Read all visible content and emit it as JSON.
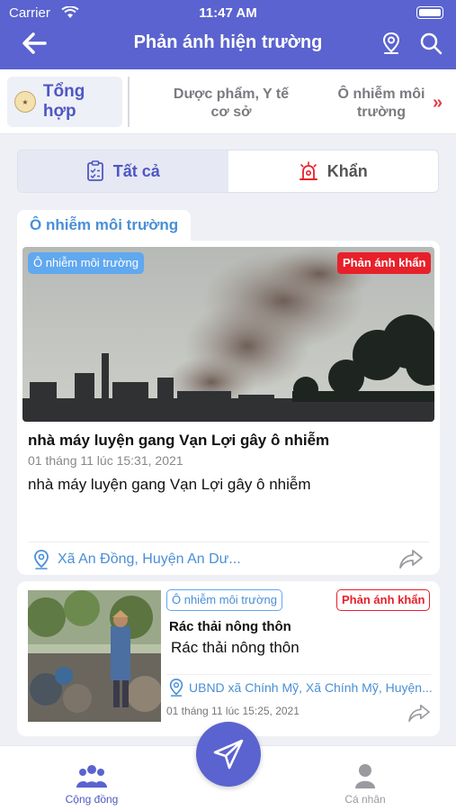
{
  "status_bar": {
    "carrier": "Carrier",
    "time": "11:47 AM"
  },
  "header": {
    "title": "Phản ánh hiện trường"
  },
  "categories": {
    "active": "Tổng hợp",
    "items": [
      "Dược phẩm, Y tế cơ sở",
      "Ô nhiễm môi trường"
    ]
  },
  "segments": {
    "all": "Tất cả",
    "urgent": "Khẩn"
  },
  "section_label": "Ô nhiễm môi trường",
  "posts": [
    {
      "category_tag": "Ô nhiễm môi trường",
      "urgent_tag": "Phản ánh khẩn",
      "title": "nhà máy luyện gang Vạn Lợi gây ô nhiễm",
      "date": "01 tháng 11 lúc 15:31, 2021",
      "description": "nhà máy luyện gang Vạn Lợi gây ô nhiễm",
      "address": "Xã An Đồng, Huyện An Dư..."
    },
    {
      "category_tag": "Ô nhiễm môi trường",
      "urgent_tag": "Phản ánh khẩn",
      "title": "Rác thải nông thôn",
      "description": "Rác thải nông thôn",
      "address": "UBND xã Chính Mỹ, Xã Chính Mỹ, Huyện...",
      "date": "01 tháng 11 lúc 15:25, 2021"
    }
  ],
  "tabbar": {
    "community": "Cộng đồng",
    "personal": "Cá nhân"
  },
  "colors": {
    "primary": "#5a63cf",
    "link": "#4a8fd6",
    "urgent": "#e8202a",
    "tag_blue": "#60a8ef"
  }
}
